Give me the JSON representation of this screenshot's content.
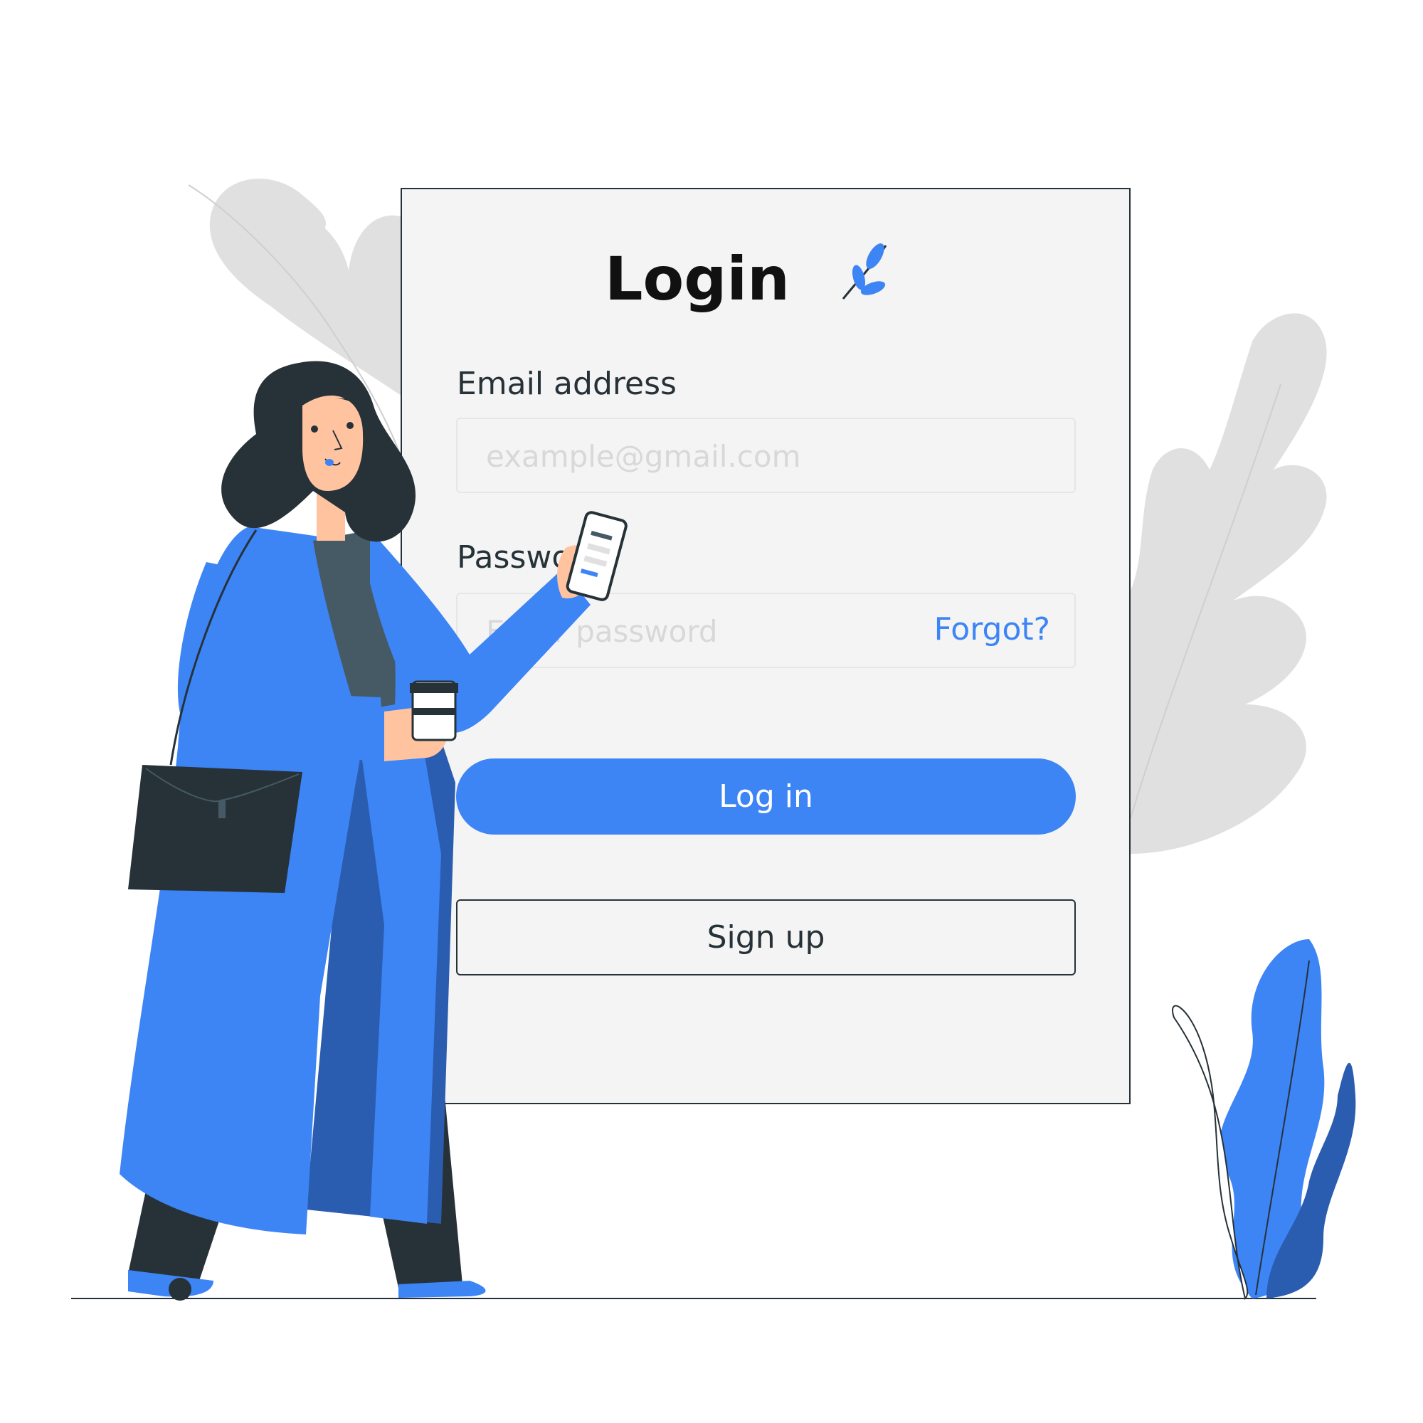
{
  "form": {
    "title": "Login",
    "email_label": "Email address",
    "email_placeholder": "example@gmail.com",
    "password_label": "Password",
    "password_placeholder": "Enter password",
    "forgot_link": "Forgot?",
    "login_button": "Log in",
    "signup_button": "Sign up"
  },
  "colors": {
    "accent": "#3d84f5",
    "accent_dark": "#2a5cb0",
    "card_background": "#f4f4f4",
    "ink": "#263238",
    "leaf_gray": "#e0e0e0"
  },
  "icons": [
    "leaf-sprig-icon",
    "phone-icon",
    "coffee-cup-icon",
    "handbag-icon"
  ]
}
